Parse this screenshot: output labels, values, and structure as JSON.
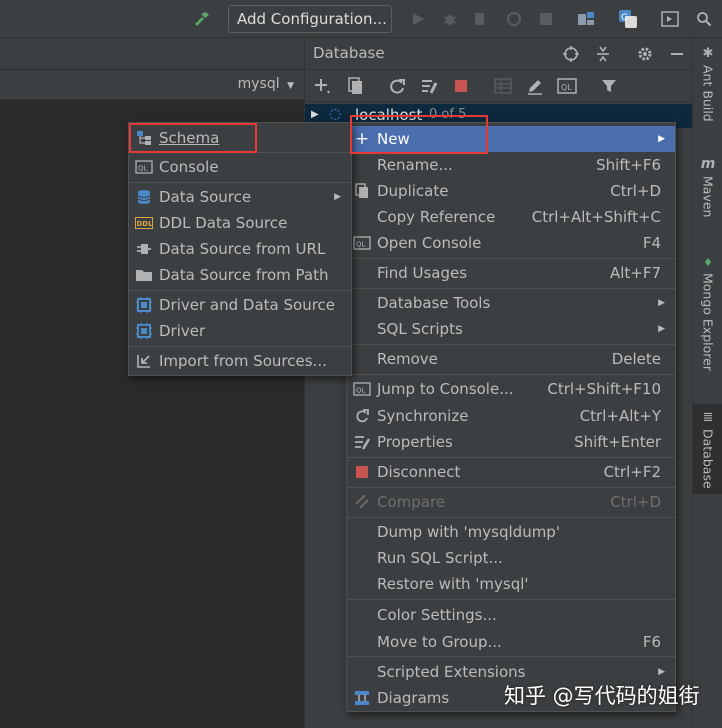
{
  "topbar": {
    "add_configuration": "Add Configuration..."
  },
  "editor": {
    "datasource_label": "mysql"
  },
  "db_panel": {
    "title": "Database",
    "tree_root_label": "localhost",
    "tree_root_count": "0 of 5"
  },
  "right_stripe": [
    "Ant Build",
    "Maven",
    "Mongo Explorer",
    "Database"
  ],
  "context_menu": {
    "items": [
      {
        "label": "New",
        "shortcut": ""
      },
      {
        "label": "Rename...",
        "shortcut": "Shift+F6"
      },
      {
        "label": "Duplicate",
        "shortcut": "Ctrl+D"
      },
      {
        "label": "Copy Reference",
        "shortcut": "Ctrl+Alt+Shift+C"
      },
      {
        "label": "Open Console",
        "shortcut": "F4"
      },
      {
        "label": "Find Usages",
        "shortcut": "Alt+F7"
      },
      {
        "label": "Database Tools",
        "shortcut": ""
      },
      {
        "label": "SQL Scripts",
        "shortcut": ""
      },
      {
        "label": "Remove",
        "shortcut": "Delete"
      },
      {
        "label": "Jump to Console...",
        "shortcut": "Ctrl+Shift+F10"
      },
      {
        "label": "Synchronize",
        "shortcut": "Ctrl+Alt+Y"
      },
      {
        "label": "Properties",
        "shortcut": "Shift+Enter"
      },
      {
        "label": "Disconnect",
        "shortcut": "Ctrl+F2"
      },
      {
        "label": "Compare",
        "shortcut": "Ctrl+D"
      },
      {
        "label": "Dump with 'mysqldump'",
        "shortcut": ""
      },
      {
        "label": "Run SQL Script...",
        "shortcut": ""
      },
      {
        "label": "Restore with 'mysql'",
        "shortcut": ""
      },
      {
        "label": "Color Settings...",
        "shortcut": ""
      },
      {
        "label": "Move to Group...",
        "shortcut": "F6"
      },
      {
        "label": "Scripted Extensions",
        "shortcut": ""
      },
      {
        "label": "Diagrams",
        "shortcut": ""
      }
    ]
  },
  "new_submenu": {
    "items": [
      {
        "label": "Schema"
      },
      {
        "label": "Console"
      },
      {
        "label": "Data Source"
      },
      {
        "label": "DDL Data Source"
      },
      {
        "label": "Data Source from URL"
      },
      {
        "label": "Data Source from Path"
      },
      {
        "label": "Driver and Data Source"
      },
      {
        "label": "Driver"
      },
      {
        "label": "Import from Sources..."
      }
    ]
  },
  "watermark": "知乎 @写代码的姐街",
  "colors": {
    "selection": "#4b6eaf",
    "highlight_box": "#e53935",
    "menu_bg": "#3c3f41",
    "editor_bg": "#2b2b2b"
  }
}
